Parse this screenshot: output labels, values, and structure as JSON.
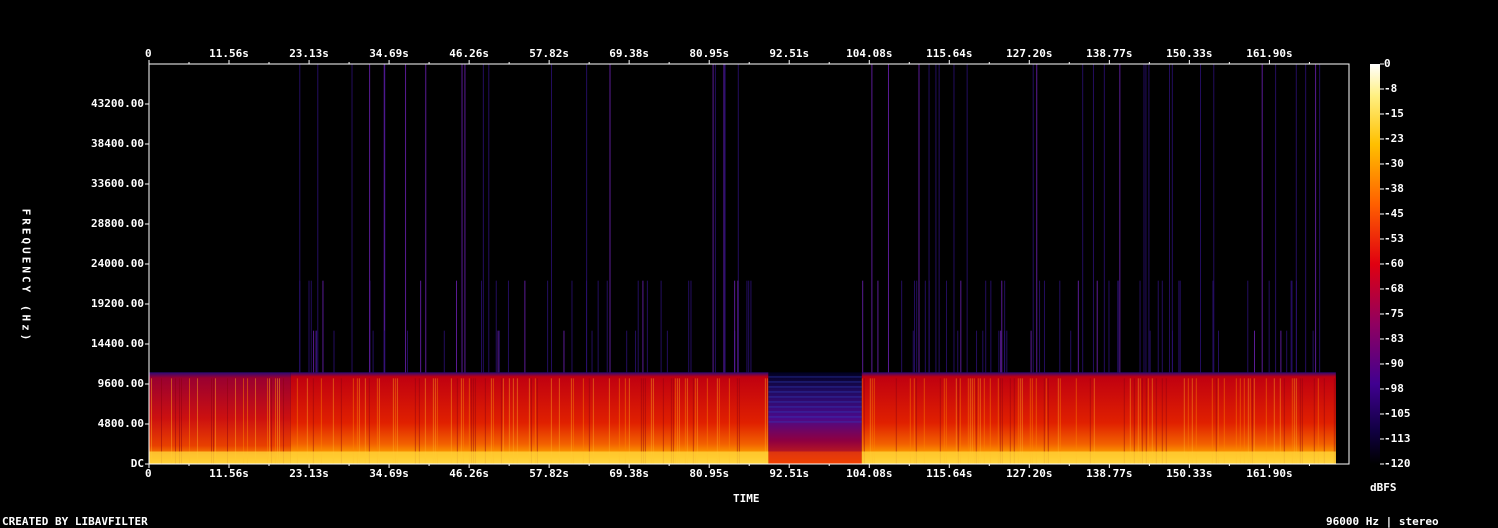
{
  "chart_data": {
    "type": "heatmap",
    "title": "",
    "xlabel": "TIME",
    "ylabel": "FREQUENCY (Hz)",
    "x_ticks": [
      "0",
      "11.56s",
      "23.13s",
      "34.69s",
      "46.26s",
      "57.82s",
      "69.38s",
      "80.95s",
      "92.51s",
      "104.08s",
      "115.64s",
      "127.20s",
      "138.77s",
      "150.33s",
      "161.90s"
    ],
    "x_tick_values": [
      0,
      11.56,
      23.13,
      34.69,
      46.26,
      57.82,
      69.38,
      80.95,
      92.51,
      104.08,
      115.64,
      127.2,
      138.77,
      150.33,
      161.9
    ],
    "xlim": [
      0,
      173.4
    ],
    "y_ticks": [
      "DC",
      "4800.00",
      "9600.00",
      "14400.00",
      "19200.00",
      "24000.00",
      "28800.00",
      "33600.00",
      "38400.00",
      "43200.00"
    ],
    "y_tick_values": [
      0,
      4800,
      9600,
      14400,
      19200,
      24000,
      28800,
      33600,
      38400,
      43200
    ],
    "ylim": [
      0,
      48000
    ],
    "colorbar": {
      "label": "dBFS",
      "ticks": [
        "0",
        "-8",
        "-15",
        "-23",
        "-30",
        "-38",
        "-45",
        "-53",
        "-60",
        "-68",
        "-75",
        "-83",
        "-90",
        "-98",
        "-105",
        "-113",
        "-120"
      ],
      "range": [
        -120,
        0
      ]
    },
    "content_bandwidth_hz": 11000,
    "segments": [
      {
        "start": 0,
        "end": 20.5,
        "level": "medium"
      },
      {
        "start": 20.5,
        "end": 89.5,
        "level": "high"
      },
      {
        "start": 89.5,
        "end": 103,
        "level": "low"
      },
      {
        "start": 103,
        "end": 171.5,
        "level": "high"
      }
    ]
  },
  "footer": {
    "credit": "CREATED BY LIBAVFILTER",
    "info": "96000 Hz | stereo"
  },
  "colors": {
    "background": "#000000",
    "axis": "#ffffff"
  }
}
